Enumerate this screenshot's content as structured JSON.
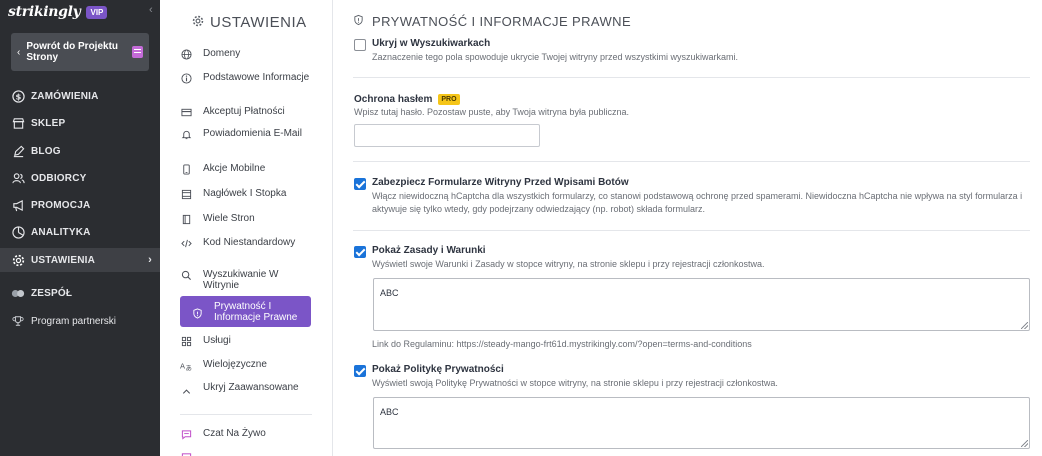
{
  "brand": {
    "logo": "strikingly",
    "badge": "VIP"
  },
  "back_button": {
    "label": "Powrót do Projektu Strony"
  },
  "sidebar": {
    "items": [
      {
        "label": "ZAMÓWIENIA",
        "icon": "dollar-icon"
      },
      {
        "label": "SKLEP",
        "icon": "store-icon"
      },
      {
        "label": "BLOG",
        "icon": "pen-icon"
      },
      {
        "label": "ODBIORCY",
        "icon": "users-icon"
      },
      {
        "label": "PROMOCJA",
        "icon": "megaphone-icon"
      },
      {
        "label": "ANALITYKA",
        "icon": "analytics-icon"
      },
      {
        "label": "USTAWIENIA",
        "icon": "gear-icon",
        "active": true,
        "arrow": "›"
      },
      {
        "label": "ZESPÓŁ",
        "icon": "team-icon"
      },
      {
        "label": "Program partnerski",
        "icon": "trophy-icon"
      }
    ]
  },
  "settings": {
    "title": "USTAWIENIA",
    "items": [
      {
        "label": "Domeny"
      },
      {
        "label": "Podstawowe Informacje"
      },
      {
        "label": "Akceptuj Płatności"
      },
      {
        "label": "Powiadomienia E-Mail"
      },
      {
        "label": "Akcje Mobilne"
      },
      {
        "label": "Nagłówek I Stopka"
      },
      {
        "label": "Wiele Stron"
      },
      {
        "label": "Kod Niestandardowy"
      },
      {
        "label": "Wyszukiwanie W Witrynie"
      },
      {
        "label": "Prywatność I Informacje Prawne",
        "active": true
      },
      {
        "label": "Usługi"
      },
      {
        "label": "Wielojęzyczne"
      },
      {
        "label": "Ukryj Zaawansowane"
      },
      {
        "label": "Czat Na Żywo"
      }
    ]
  },
  "main": {
    "title": "PRYWATNOŚĆ I INFORMACJE PRAWNE",
    "hide_search": {
      "title": "Ukryj w Wyszukiwarkach",
      "desc": "Zaznaczenie tego pola spowoduje ukrycie Twojej witryny przed wszystkimi wyszukiwarkami.",
      "checked": false
    },
    "password": {
      "title": "Ochrona hasłem",
      "badge": "PRO",
      "desc": "Wpisz tutaj hasło. Pozostaw puste, aby Twoja witryna była publiczna.",
      "value": ""
    },
    "bots": {
      "title": "Zabezpiecz Formularze Witryny Przed Wpisami Botów",
      "desc": "Włącz niewidoczną hCaptcha dla wszystkich formularzy, co stanowi podstawową ochronę przed spamerami. Niewidoczna hCaptcha nie wpływa na styl formularza i aktywuje się tylko wtedy, gdy podejrzany odwiedzający (np. robot) składa formularz.",
      "checked": true
    },
    "terms": {
      "title": "Pokaż Zasady i Warunki",
      "desc": "Wyświetl swoje Warunki i Zasady w stopce witryny, na stronie sklepu i przy rejestracji członkostwa.",
      "checked": true,
      "text": "ABC",
      "link": "Link do Regulaminu: https://steady-mango-frt61d.mystrikingly.com/?open=terms-and-conditions"
    },
    "privacy": {
      "title": "Pokaż Politykę Prywatności",
      "desc": "Wyświetl swoją Politykę Prywatności w stopce witryny, na stronie sklepu i przy rejestracji członkostwa.",
      "checked": true,
      "text": "ABC"
    }
  },
  "colors": {
    "sidebar": "#2b2d31",
    "accent": "#7b55c7",
    "checkbox": "#1a73d9",
    "pro": "#f5c518"
  }
}
